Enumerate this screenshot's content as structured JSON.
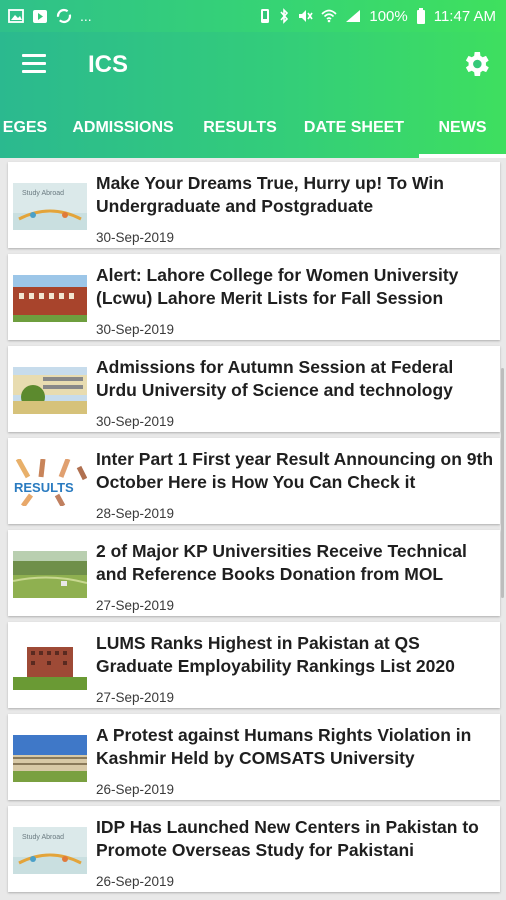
{
  "status_bar": {
    "left_icons": [
      "image-icon",
      "play-store-icon",
      "sync-icon"
    ],
    "left_more": "...",
    "battery_pct": "100%",
    "time": "11:47 AM"
  },
  "app_bar": {
    "title": "ICS",
    "accent": "#36d474"
  },
  "tabs": [
    {
      "label": "EGES",
      "active": false
    },
    {
      "label": "ADMISSIONS",
      "active": false
    },
    {
      "label": "RESULTS",
      "active": false
    },
    {
      "label": "DATE SHEET",
      "active": false
    },
    {
      "label": "NEWS",
      "active": true
    }
  ],
  "news": [
    {
      "title": "Make Your Dreams True, Hurry up! To Win Undergraduate and Postgraduate",
      "date": "30-Sep-2019",
      "thumb": "study-abroad"
    },
    {
      "title": "Alert: Lahore College for Women University (Lcwu) Lahore Merit Lists for Fall Session",
      "date": "30-Sep-2019",
      "thumb": "building"
    },
    {
      "title": "Admissions for Autumn Session at Federal Urdu University of Science and technology",
      "date": "30-Sep-2019",
      "thumb": "campus"
    },
    {
      "title": "Inter Part 1 First year Result Announcing on 9th October Here is How You Can Check it",
      "date": "28-Sep-2019",
      "thumb": "results"
    },
    {
      "title": "2 of Major KP Universities Receive Technical and Reference Books Donation from MOL",
      "date": "27-Sep-2019",
      "thumb": "landscape"
    },
    {
      "title": "LUMS Ranks Highest in Pakistan at QS Graduate Employability Rankings List 2020",
      "date": "27-Sep-2019",
      "thumb": "tower"
    },
    {
      "title": "A Protest against Humans Rights Violation in Kashmir Held by COMSATS University",
      "date": "26-Sep-2019",
      "thumb": "university"
    },
    {
      "title": "IDP Has Launched New Centers in Pakistan to Promote Overseas Study for Pakistani",
      "date": "26-Sep-2019",
      "thumb": "study-abroad"
    }
  ],
  "thumb_text": {
    "study_abroad": "Study Abroad",
    "results": "RESULTS"
  }
}
